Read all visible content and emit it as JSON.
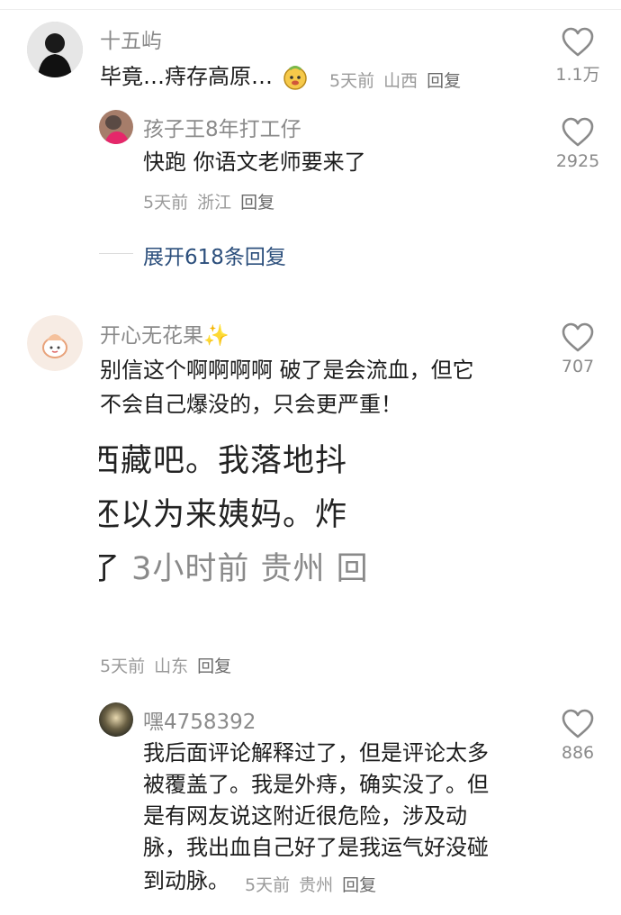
{
  "comments": [
    {
      "username": "十五屿",
      "text": "毕竟…痔存高原…",
      "emoji": "face-emoji",
      "time": "5天前",
      "location": "山西",
      "reply_label": "回复",
      "likes": "1.1万"
    },
    {
      "username": "孩子王8年打工仔",
      "text": "快跑 你语文老师要来了",
      "time": "5天前",
      "location": "浙江",
      "reply_label": "回复",
      "likes": "2925"
    },
    {
      "username": "开心无花果✨",
      "text_lines": [
        "别信这个啊啊啊啊 破了是会流血，但它",
        "不会自己爆没的，只会更严重！"
      ],
      "image_lines": [
        "西藏吧。我落地抖",
        "还以为来姨妈。炸",
        "了 3小时前 贵州 回"
      ],
      "image_time": "3小时前 贵州 回",
      "time": "5天前",
      "location": "山东",
      "reply_label": "回复",
      "likes": "707"
    },
    {
      "username": "嘿4758392",
      "text_lines": [
        "我后面评论解释过了，但是评论太多",
        "被覆盖了。我是外痔，确实没了。但",
        "是有网友说这附近很危险，涉及动",
        "脉，我出血自己好了是我运气好没碰"
      ],
      "last_line": "到动脉。",
      "time": "5天前",
      "location": "贵州",
      "reply_label": "回复",
      "likes": "886"
    }
  ],
  "expand_replies": "展开618条回复",
  "colors": {
    "link": "#2c4f7c",
    "meta": "#9a9a9a",
    "name": "#8a8a8a"
  }
}
